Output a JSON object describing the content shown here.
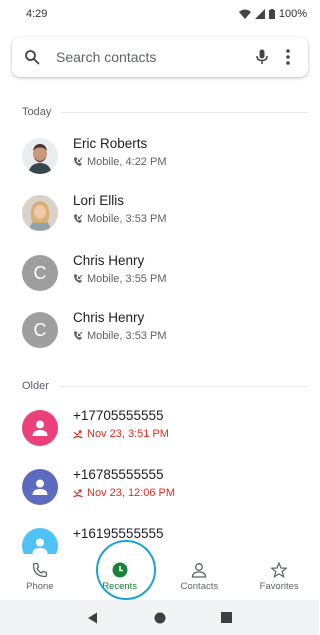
{
  "status": {
    "time": "4:29",
    "battery": "100%"
  },
  "search": {
    "placeholder": "Search contacts"
  },
  "sections": {
    "today": "Today",
    "older": "Older"
  },
  "calls": [
    {
      "name": "Eric Roberts",
      "detail": "Mobile, 4:22 PM",
      "type": "incoming",
      "avatar": "photo",
      "color": "#8d6e63"
    },
    {
      "name": "Lori Ellis",
      "detail": "Mobile, 3:53 PM",
      "type": "incoming",
      "avatar": "photo",
      "color": "#c9a27e"
    },
    {
      "name": "Chris Henry",
      "detail": "Mobile, 3:55 PM",
      "type": "incoming",
      "avatar": "C",
      "color": "#9e9e9e"
    },
    {
      "name": "Chris Henry",
      "detail": "Mobile, 3:53 PM",
      "type": "incoming",
      "avatar": "C",
      "color": "#9e9e9e"
    },
    {
      "name": "+17705555555",
      "detail": "Nov 23, 3:51 PM",
      "type": "missed",
      "avatar": "person",
      "color": "#ec407a"
    },
    {
      "name": "+16785555555",
      "detail": "Nov 23, 12:06 PM",
      "type": "missed",
      "avatar": "person",
      "color": "#5c6bc0"
    },
    {
      "name": "+16195555555",
      "detail": "",
      "type": "incoming",
      "avatar": "person",
      "color": "#4fc3f7"
    }
  ],
  "nav": {
    "phone": "Phone",
    "recents": "Recents",
    "contacts": "Contacts",
    "favorites": "Favorites",
    "active": "recents",
    "active_color": "#188038"
  }
}
